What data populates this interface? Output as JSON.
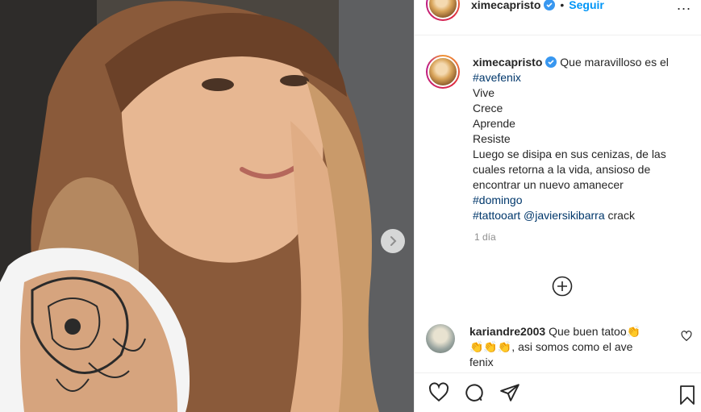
{
  "post": {
    "username": "ximecapristo",
    "separator": "•",
    "follow_label": "Seguir",
    "more_label": "...",
    "caption": {
      "username": "ximecapristo",
      "text_start": "Que maravilloso es el",
      "hashtag1": "#avefenix",
      "line_vive": "Vive",
      "line_crece": "Crece",
      "line_aprende": "Aprende",
      "line_resiste": "Resiste",
      "line_luego1": "Luego se disipa en sus cenizas, de las",
      "line_luego2": "cuales retorna a la vida, ansioso de",
      "line_luego3": "encontrar un nuevo amanecer",
      "hashtag2": "#domingo",
      "hashtag3": "#tattooart",
      "mention": "@javiersikibarra",
      "end_word": "crack"
    },
    "time_ago": "1 día",
    "comment": {
      "username": "kariandre2003",
      "text1": "Que buen tatoo👏",
      "text2": "👏👏👏, asi somos como el ave",
      "text3": "fenix"
    },
    "icons": {
      "verified": "verified-badge-icon",
      "next": "chevron-right-icon",
      "load_more": "plus-circle-icon",
      "like": "heart-icon",
      "comment": "comment-bubble-icon",
      "share": "paper-plane-icon",
      "save": "bookmark-icon"
    },
    "colors": {
      "link": "#0095f6",
      "hashtag": "#00376b",
      "meta": "#8e8e8e"
    }
  }
}
